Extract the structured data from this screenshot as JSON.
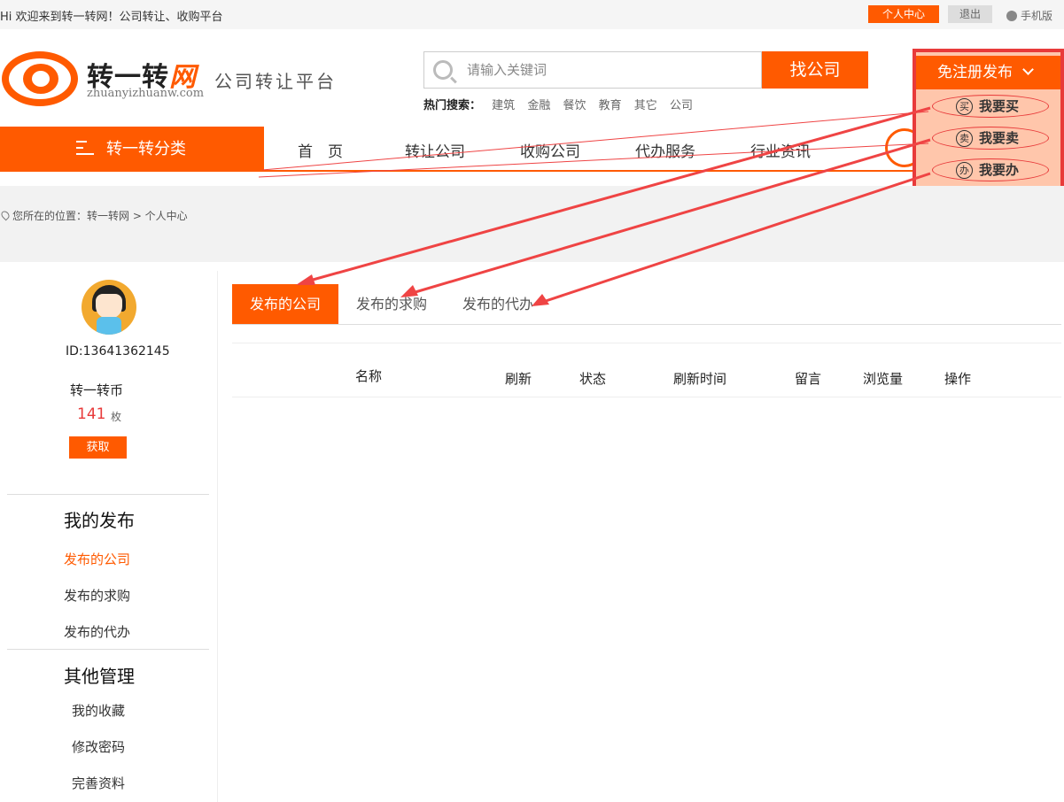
{
  "topbar": {
    "welcome": "Hi 欢迎来到转一转网！公司转让、收购平台",
    "center": "个人中心",
    "logout": "退出",
    "mobile": "手机版"
  },
  "logo": {
    "brand_main": "转一转",
    "brand_accent": "网",
    "pinyin": "zhuanyizhuanw.com",
    "slogan": "公司转让平台"
  },
  "search": {
    "placeholder": "请输入关键词",
    "button": "找公司",
    "hot_label": "热门搜索：",
    "hot_items": [
      "建筑",
      "金融",
      "餐饮",
      "教育",
      "其它",
      "公司"
    ]
  },
  "publish": {
    "header": "免注册发布",
    "options": [
      {
        "icon": "买",
        "label": "我要买"
      },
      {
        "icon": "卖",
        "label": "我要卖"
      },
      {
        "icon": "办",
        "label": "我要办"
      }
    ]
  },
  "nav": {
    "category": "转一转分类",
    "items": [
      "首　页",
      "转让公司",
      "收购公司",
      "代办服务",
      "行业资讯"
    ]
  },
  "breadcrumb": "您所在的位置：转一转网 > 个人中心",
  "user": {
    "id": "ID:13641362145",
    "coin_label": "转一转币",
    "coin_value": "141",
    "coin_unit": "枚",
    "get_button": "获取"
  },
  "sidebar": {
    "section1_title": "我的发布",
    "section1_links": [
      "发布的公司",
      "发布的求购",
      "发布的代办"
    ],
    "section2_title": "其他管理",
    "section2_links": [
      "我的收藏",
      "修改密码",
      "完善资料"
    ]
  },
  "tabs": [
    "发布的公司",
    "发布的求购",
    "发布的代办"
  ],
  "table_headers": [
    "名称",
    "刷新",
    "状态",
    "刷新时间",
    "留言",
    "浏览量",
    "操作"
  ],
  "colors": {
    "accent": "#ff5a00",
    "annotation": "#e83a3a"
  }
}
